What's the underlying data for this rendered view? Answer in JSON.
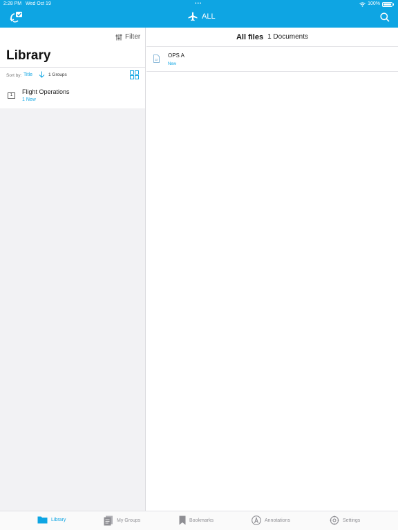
{
  "status_bar": {
    "time": "2:28 PM",
    "date": "Wed Oct 19",
    "battery": "100%"
  },
  "topbar": {
    "title": "ALL"
  },
  "library": {
    "filter_label": "Filter",
    "title": "Library",
    "sort_label": "Sort by:",
    "sort_value": "Title",
    "groups_count": "1 Groups",
    "groups": [
      {
        "badge": "1",
        "name": "Flight Operations",
        "status": "1 New"
      }
    ]
  },
  "files": {
    "title": "All files",
    "count": "1 Documents",
    "documents": [
      {
        "name": "OPS A",
        "status": "New"
      }
    ]
  },
  "tabs": [
    {
      "label": "Library",
      "icon": "folder-icon",
      "active": true
    },
    {
      "label": "My Groups",
      "icon": "documents-icon",
      "active": false
    },
    {
      "label": "Bookmarks",
      "icon": "bookmark-icon",
      "active": false
    },
    {
      "label": "Annotations",
      "icon": "pen-icon",
      "active": false
    },
    {
      "label": "Settings",
      "icon": "gear-icon",
      "active": false
    }
  ],
  "colors": {
    "accent": "#0ea5e3",
    "sidebar_bg": "#f2f2f4"
  }
}
